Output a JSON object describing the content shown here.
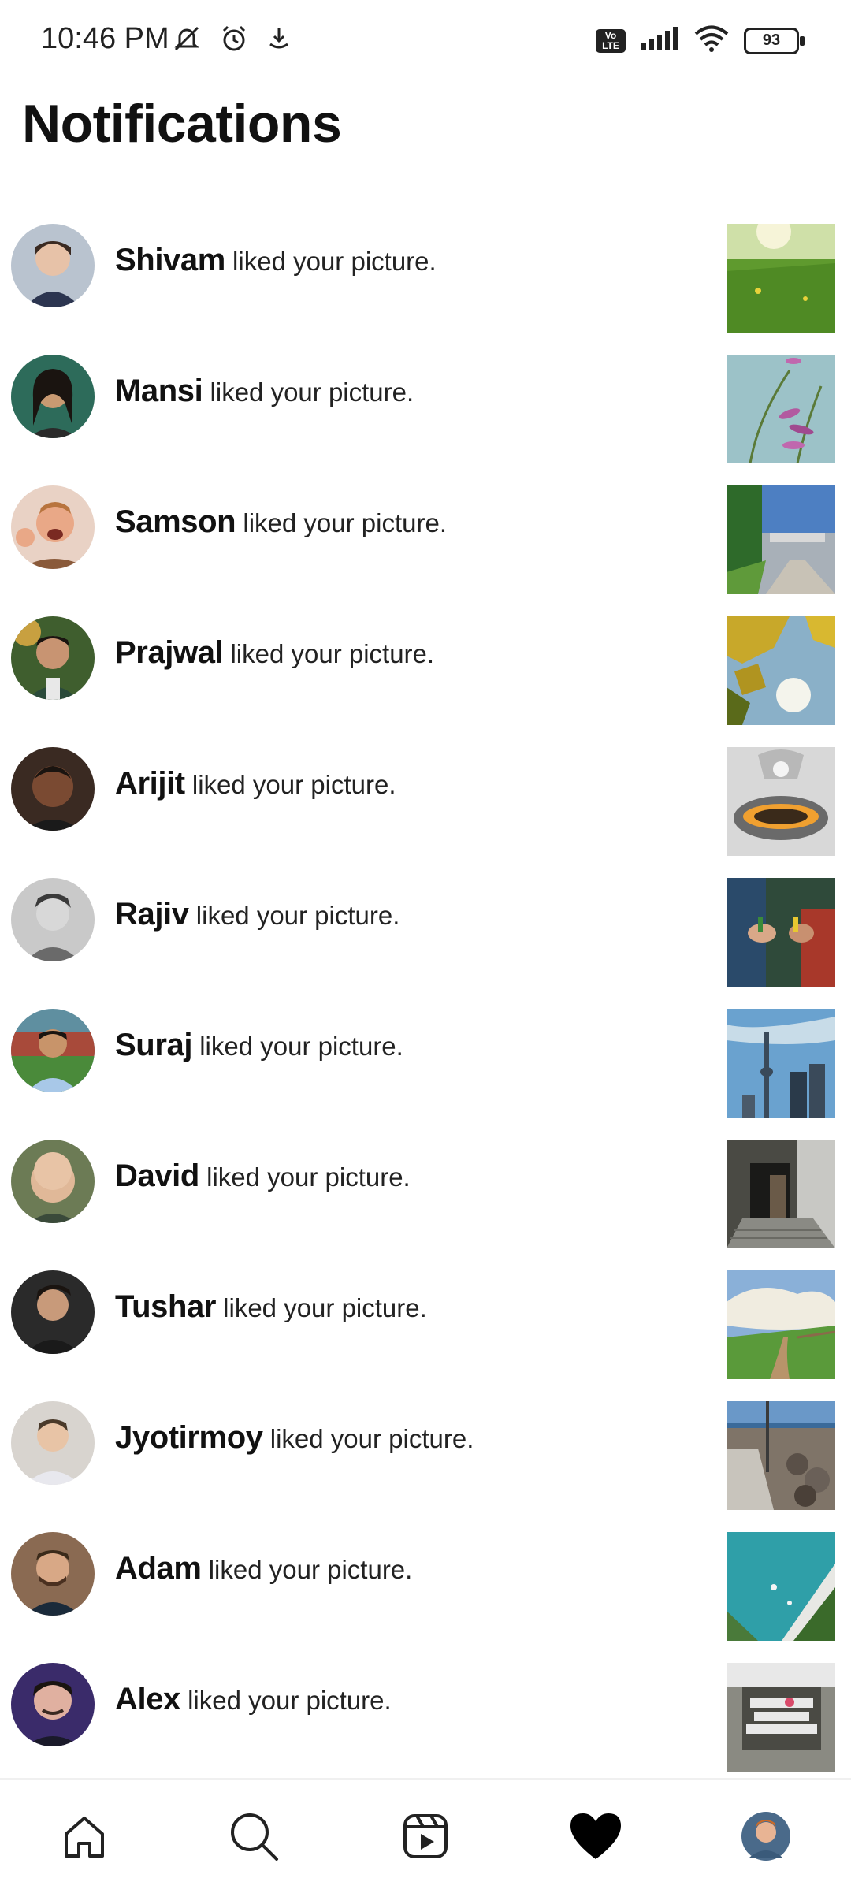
{
  "status_bar": {
    "time": "10:46 PM",
    "battery": "93",
    "volte_label": "Vo LTE",
    "icons_left": [
      "mute-icon",
      "alarm-icon",
      "download-icon"
    ],
    "icons_right": [
      "volte-icon",
      "signal-icon",
      "wifi-icon",
      "battery-icon"
    ]
  },
  "page": {
    "title": "Notifications"
  },
  "notifications": [
    {
      "name": "Shivam",
      "action": " liked your picture.",
      "avatar_color": "#b9c3cf",
      "thumb_color": "#5f9a2e"
    },
    {
      "name": "Mansi",
      "action": " liked your picture.",
      "avatar_color": "#2d6b5a",
      "thumb_color": "#7ea8b0"
    },
    {
      "name": "Samson",
      "action": " liked your picture.",
      "avatar_color": "#e9d2c5",
      "thumb_color": "#4d7fc2"
    },
    {
      "name": "Prajwal",
      "action": " liked your picture.",
      "avatar_color": "#3f5e2e",
      "thumb_color": "#7c8a2a"
    },
    {
      "name": "Arijit",
      "action": " liked your picture.",
      "avatar_color": "#3a2a22",
      "thumb_color": "#9a9a9a"
    },
    {
      "name": "Rajiv",
      "action": " liked your picture.",
      "avatar_color": "#c9c9c9",
      "thumb_color": "#2f4a3a"
    },
    {
      "name": "Suraj",
      "action": " liked your picture.",
      "avatar_color": "#5f8fa0",
      "thumb_color": "#6aa2cf"
    },
    {
      "name": "David",
      "action": " liked your picture.",
      "avatar_color": "#6c7b55",
      "thumb_color": "#4a4a44"
    },
    {
      "name": "Tushar",
      "action": " liked your picture.",
      "avatar_color": "#2a2a2a",
      "thumb_color": "#8ab0d8"
    },
    {
      "name": "Jyotirmoy",
      "action": " liked your picture.",
      "avatar_color": "#d8d4cf",
      "thumb_color": "#7f7468"
    },
    {
      "name": "Adam",
      "action": " liked your picture.",
      "avatar_color": "#8a6a52",
      "thumb_color": "#2f9fa8"
    },
    {
      "name": "Alex",
      "action": " liked your picture.",
      "avatar_color": "#3a2b6a",
      "thumb_color": "#8a8a82"
    }
  ],
  "bottom_nav": {
    "items": [
      "home-icon",
      "search-icon",
      "reels-icon",
      "heart-icon",
      "profile-avatar"
    ]
  }
}
